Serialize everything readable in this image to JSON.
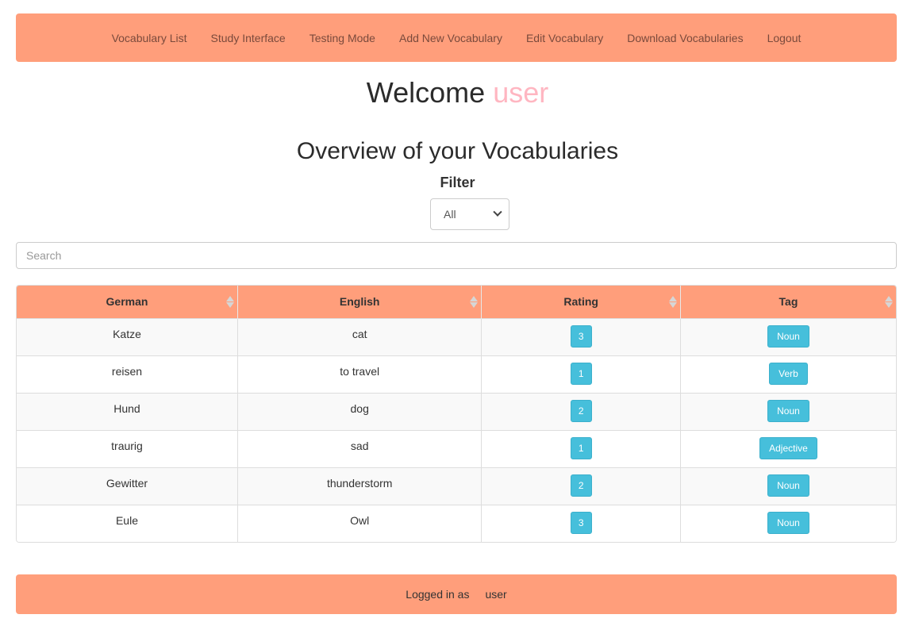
{
  "nav": {
    "items": [
      {
        "label": "Vocabulary List"
      },
      {
        "label": "Study Interface"
      },
      {
        "label": "Testing Mode"
      },
      {
        "label": "Add New Vocabulary"
      },
      {
        "label": "Edit Vocabulary"
      },
      {
        "label": "Download Vocabularies"
      },
      {
        "label": "Logout"
      }
    ]
  },
  "welcome": {
    "prefix": "Welcome",
    "username": "user"
  },
  "overview_title": "Overview of your Vocabularies",
  "filter": {
    "label": "Filter",
    "selected": "All"
  },
  "search": {
    "placeholder": "Search",
    "value": ""
  },
  "table": {
    "columns": [
      "German",
      "English",
      "Rating",
      "Tag"
    ],
    "rows": [
      {
        "german": "Katze",
        "english": "cat",
        "rating": "3",
        "tag": "Noun"
      },
      {
        "german": "reisen",
        "english": "to travel",
        "rating": "1",
        "tag": "Verb"
      },
      {
        "german": "Hund",
        "english": "dog",
        "rating": "2",
        "tag": "Noun"
      },
      {
        "german": "traurig",
        "english": "sad",
        "rating": "1",
        "tag": "Adjective"
      },
      {
        "german": "Gewitter",
        "english": "thunderstorm",
        "rating": "2",
        "tag": "Noun"
      },
      {
        "german": "Eule",
        "english": "Owl",
        "rating": "3",
        "tag": "Noun"
      }
    ]
  },
  "footer": {
    "label": "Logged in as",
    "username": "user"
  },
  "colors": {
    "brand": "#ff9e7b",
    "badge": "#46bfdb",
    "username": "#ffb6c1"
  }
}
